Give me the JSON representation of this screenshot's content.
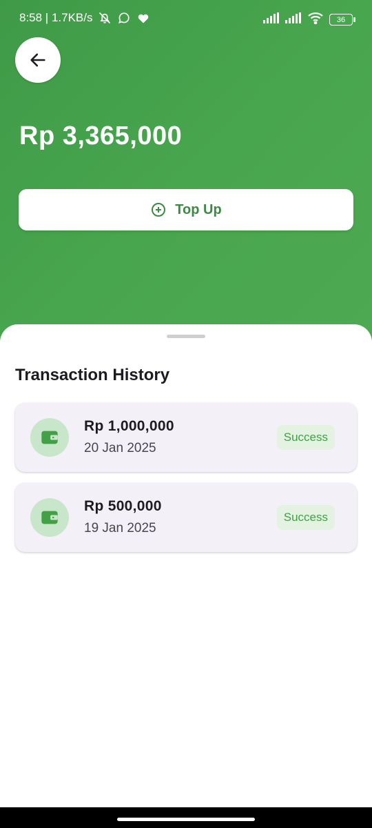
{
  "status_bar": {
    "time_speed": "8:58 | 1.7KB/s",
    "battery": "36",
    "icons": [
      "mute-bell-icon",
      "whatsapp-icon",
      "app-notification-icon",
      "signal-icon",
      "signal-icon",
      "wifi-icon",
      "battery-icon"
    ]
  },
  "header": {
    "back_icon": "arrow-left-icon",
    "balance": "Rp 3,365,000",
    "topup_label": "Top Up",
    "topup_icon": "plus-circle-icon",
    "colors": {
      "gradient_start": "#3f9a47",
      "gradient_end": "#4eaa52",
      "accent": "#3b8a41"
    }
  },
  "history": {
    "title": "Transaction History",
    "transactions": [
      {
        "amount": "Rp 1,000,000",
        "date": "20 Jan 2025",
        "status": "Success",
        "icon": "wallet-icon"
      },
      {
        "amount": "Rp 500,000",
        "date": "19 Jan 2025",
        "status": "Success",
        "icon": "wallet-icon"
      }
    ],
    "colors": {
      "status_success": "#43a047",
      "icon_bg": "#c8e6ca",
      "card_bg": "#f4f0f7"
    }
  }
}
